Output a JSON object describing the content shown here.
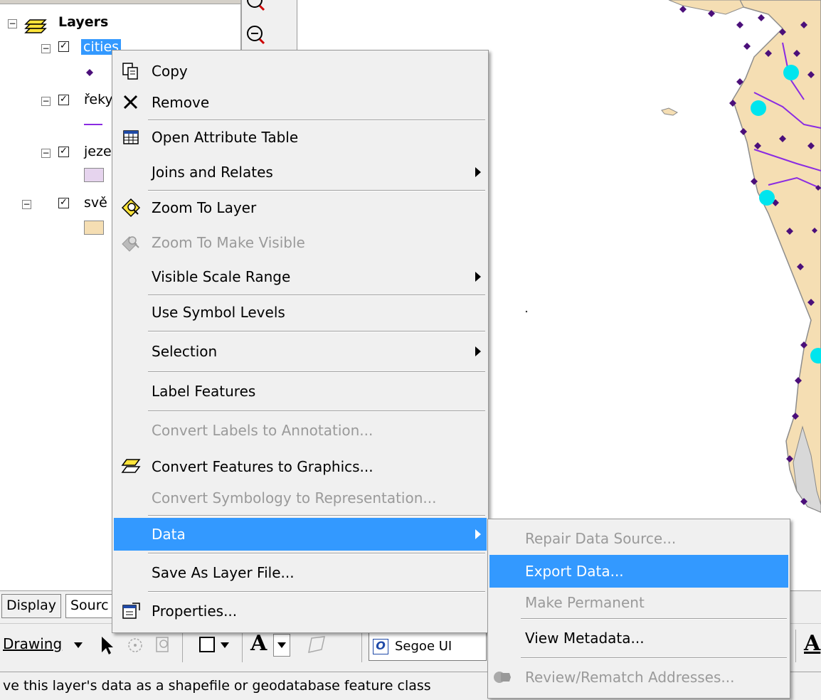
{
  "toc": {
    "root_label": "Layers",
    "layers": [
      {
        "name": "cities",
        "checked": true,
        "selected": true
      },
      {
        "name": "řeky",
        "checked": true
      },
      {
        "name": "jeze",
        "checked": true
      },
      {
        "name": "svě",
        "checked": true
      }
    ]
  },
  "colors": {
    "selection": "#3399ff",
    "menu_bg": "#f0f0f0",
    "land": "#f5deb3",
    "city_point": "#4b0f7a",
    "capital_point": "#00e5ee",
    "river": "#8a2be2",
    "lake": "#e6d4ee"
  },
  "context_menu": {
    "items": [
      {
        "label": "Copy",
        "icon": "copy-icon",
        "enabled": true
      },
      {
        "label": "Remove",
        "icon": "remove-x-icon",
        "enabled": true
      },
      {
        "label": "Open Attribute Table",
        "icon": "table-icon",
        "enabled": true
      },
      {
        "label": "Joins and Relates",
        "enabled": true,
        "submenu": true
      },
      {
        "label": "Zoom To Layer",
        "icon": "zoom-to-layer-icon",
        "enabled": true
      },
      {
        "label": "Zoom To Make Visible",
        "icon": "zoom-visible-icon",
        "enabled": false
      },
      {
        "label": "Visible Scale Range",
        "enabled": true,
        "submenu": true
      },
      {
        "label": "Use Symbol Levels",
        "enabled": true
      },
      {
        "label": "Selection",
        "enabled": true,
        "submenu": true
      },
      {
        "label": "Label Features",
        "enabled": true
      },
      {
        "label": "Convert Labels to Annotation...",
        "enabled": false
      },
      {
        "label": "Convert Features to Graphics...",
        "icon": "convert-graphics-icon",
        "enabled": true
      },
      {
        "label": "Convert Symbology to Representation...",
        "enabled": false
      },
      {
        "label": "Data",
        "enabled": true,
        "submenu": true,
        "highlighted": true
      },
      {
        "label": "Save As Layer File...",
        "enabled": true
      },
      {
        "label": "Properties...",
        "icon": "properties-icon",
        "enabled": true
      }
    ]
  },
  "data_submenu": {
    "items": [
      {
        "label": "Repair Data Source...",
        "enabled": false
      },
      {
        "label": "Export Data...",
        "enabled": true,
        "highlighted": true
      },
      {
        "label": "Make Permanent",
        "enabled": false
      },
      {
        "label": "View Metadata...",
        "enabled": true
      },
      {
        "label": "Review/Rematch Addresses...",
        "icon": "geocode-icon",
        "enabled": false
      }
    ]
  },
  "tabs": {
    "display": "Display",
    "source": "Sourc"
  },
  "drawing_toolbar": {
    "label": "Drawing",
    "font_name": "Segoe UI"
  },
  "status_bar": {
    "text": "ve this layer's data as a shapefile or geodatabase feature class"
  }
}
